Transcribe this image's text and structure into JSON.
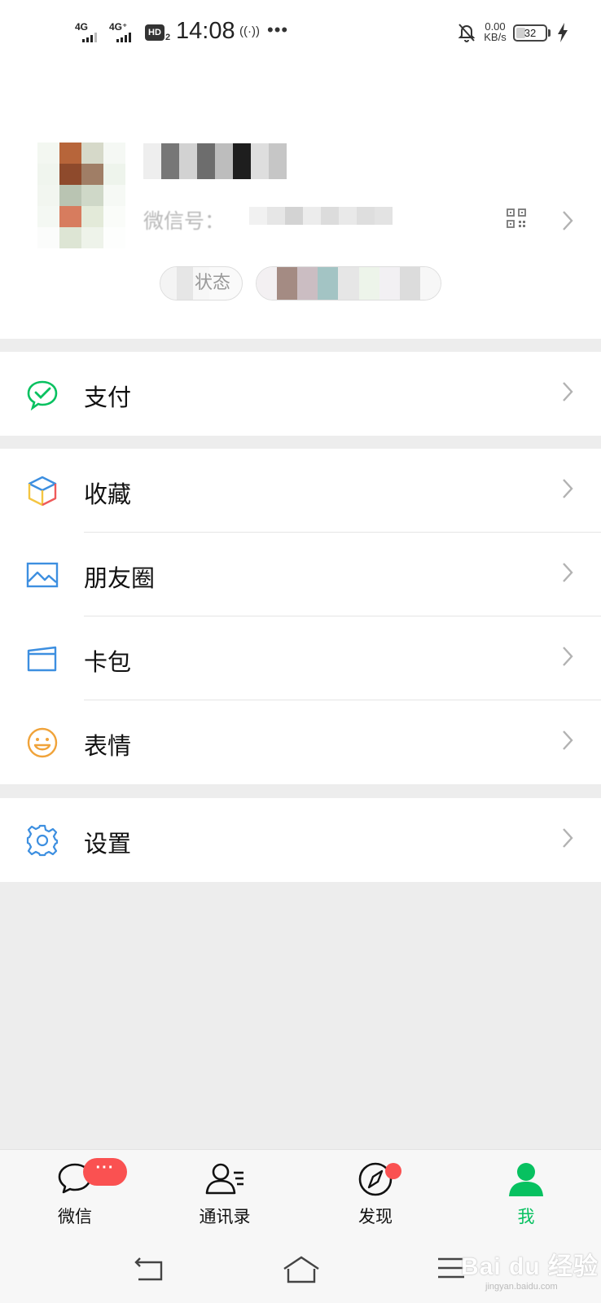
{
  "status_bar": {
    "net1": "4G",
    "net2": "4G⁺",
    "hd": "HD",
    "hd_sub": "2",
    "time": "14:08",
    "radio": "((·))",
    "more": "•••",
    "speed_value": "0.00",
    "speed_unit": "KB/s",
    "battery": "32"
  },
  "profile": {
    "wechat_id_label": "微信号：",
    "status_label": "状态"
  },
  "menu": {
    "pay": "支付",
    "favorites": "收藏",
    "moments": "朋友圈",
    "cards": "卡包",
    "stickers": "表情",
    "settings": "设置"
  },
  "tabs": {
    "chats": "微信",
    "chats_badge": "···",
    "contacts": "通讯录",
    "discover": "发现",
    "me": "我"
  },
  "watermark": {
    "brand": "Bai du 经验",
    "url": "jingyan.baidu.com"
  },
  "colors": {
    "accent_green": "#07c160",
    "badge_red": "#fa5151",
    "background": "#ededed"
  },
  "icons": {
    "pay": "wechat-pay-icon",
    "favorites": "cube-icon",
    "moments": "picture-icon",
    "cards": "card-wallet-icon",
    "stickers": "smiley-icon",
    "settings": "gear-icon"
  }
}
